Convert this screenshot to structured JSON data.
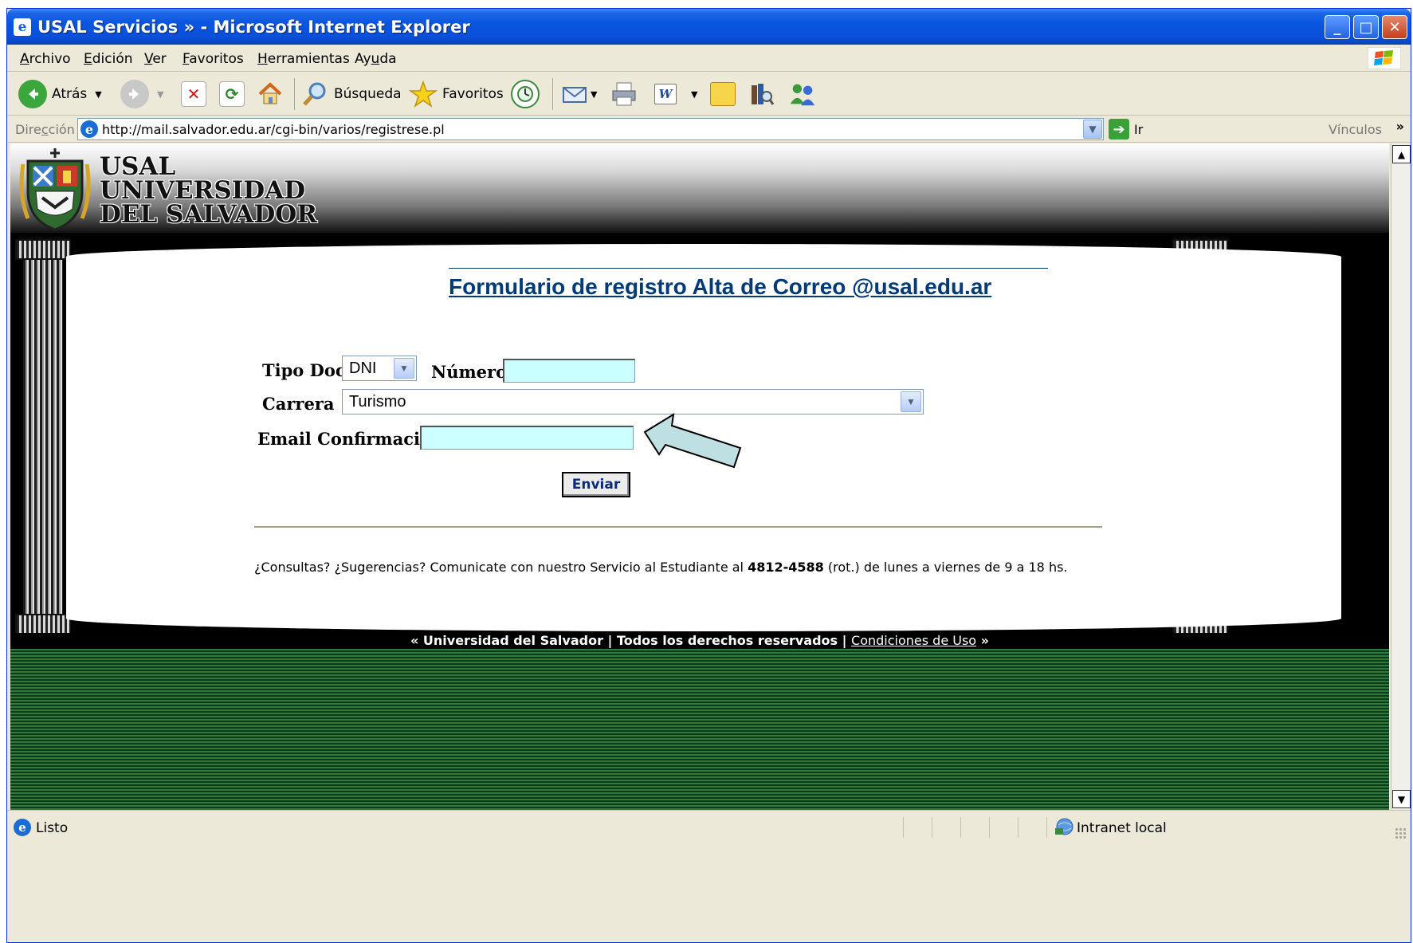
{
  "window": {
    "title": "USAL Servicios » - Microsoft Internet Explorer",
    "controls": {
      "minimize": "_",
      "maximize": "□",
      "close": "✕"
    }
  },
  "menu": {
    "items": [
      {
        "key": "A",
        "rest": "rchivo"
      },
      {
        "key": "E",
        "rest": "dición"
      },
      {
        "key": "V",
        "rest": "er"
      },
      {
        "key": "F",
        "rest": "avoritos"
      },
      {
        "key": "H",
        "rest": "erramientas"
      },
      {
        "pre": "Ay",
        "key": "u",
        "rest": "da"
      }
    ]
  },
  "toolbar": {
    "back_label": "Atrás",
    "search_label": "Búsqueda",
    "favorites_label": "Favoritos"
  },
  "address": {
    "label_pre": "Dire",
    "label_key": "c",
    "label_rest": "ción",
    "url": "http://mail.salvador.edu.ar/cgi-bin/varios/registrese.pl",
    "go_label": "Ir",
    "links_label": "Vínculos",
    "links_more": "»"
  },
  "site": {
    "name_line1": "USAL",
    "name_line2": "UNIVERSIDAD",
    "name_line3": "DEL SALVADOR"
  },
  "form": {
    "title": "Formulario de registro Alta de Correo @usal.edu.ar",
    "tipo_doc_label": "Tipo Doc:",
    "tipo_doc_value": "DNI",
    "numero_label": "Número:",
    "numero_value": "",
    "carrera_label": "Carrera",
    "carrera_value": "Turismo",
    "email_label": "Email Confirmación:",
    "email_value": "",
    "submit_label": "Enviar"
  },
  "footer": {
    "note_pre": "¿Consultas? ¿Sugerencias? Comunicate con nuestro Servicio al Estudiante al ",
    "note_phone": "4812-4588",
    "note_post": " (rot.) de lunes a viernes de 9 a 18 hs.",
    "copyright": "« Universidad del Salvador | Todos los derechos reservados | ",
    "conditions_link": "Condiciones de Uso",
    "copyright_end": " »"
  },
  "status": {
    "text": "Listo",
    "zone": "Intranet local"
  },
  "colors": {
    "title_blue": "#003a78",
    "input_bg": "#ccffff",
    "arrow_fill": "#bfe0e3",
    "xp_titlebar": "#0a55e0"
  }
}
